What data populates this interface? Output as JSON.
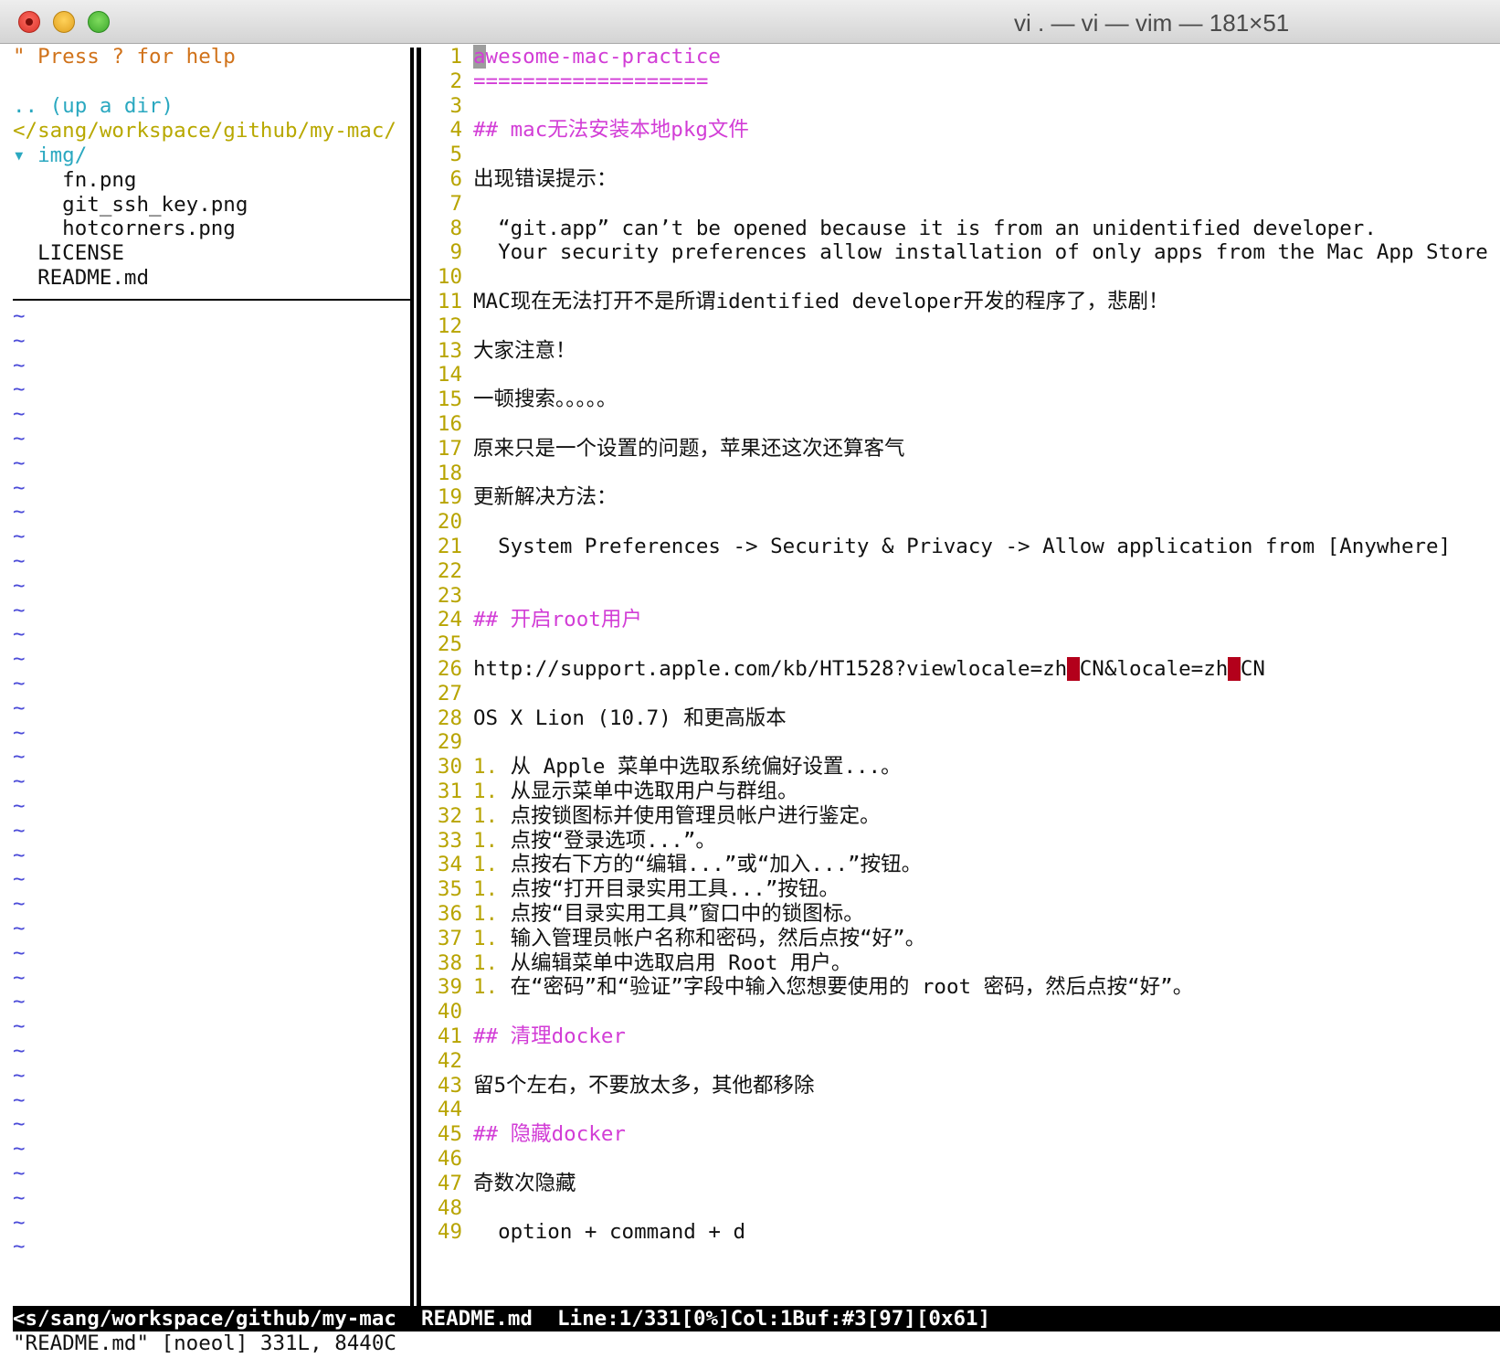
{
  "window": {
    "title": "vi . — vi — vim — 181×51"
  },
  "tree": {
    "help": "\" Press ? for help",
    "up_dir": ".. (up a dir)",
    "cwd": "</sang/workspace/github/my-mac/",
    "entries": [
      {
        "text": "▾ img/",
        "kind": "dir"
      },
      {
        "text": "    fn.png",
        "kind": "file"
      },
      {
        "text": "    git_ssh_key.png",
        "kind": "file"
      },
      {
        "text": "    hotcorners.png",
        "kind": "file"
      },
      {
        "text": "  LICENSE",
        "kind": "file"
      },
      {
        "text": "  README.md",
        "kind": "file"
      }
    ],
    "tilde": "~"
  },
  "buffer": {
    "line_numbers": [
      "1",
      "2",
      "3",
      "4",
      "5",
      "6",
      "7",
      "8",
      "9",
      "10",
      "11",
      "12",
      "13",
      "14",
      "15",
      "16",
      "17",
      "18",
      "19",
      "20",
      "21",
      "22",
      "23",
      "24",
      "25",
      "26",
      "27",
      "28",
      "29",
      "30",
      "31",
      "32",
      "33",
      "34",
      "35",
      "36",
      "37",
      "38",
      "39",
      "40",
      "41",
      "42",
      "43",
      "44",
      "45",
      "46",
      "47",
      "48",
      "49"
    ],
    "lines": [
      {
        "type": "cursorline",
        "cursor_char": "a",
        "rest": "wesome-mac-practice"
      },
      {
        "type": "heading",
        "text": "==================="
      },
      {
        "type": "text",
        "text": ""
      },
      {
        "type": "heading",
        "text": "## mac无法安装本地pkg文件"
      },
      {
        "type": "text",
        "text": ""
      },
      {
        "type": "text",
        "text": "出现错误提示："
      },
      {
        "type": "text",
        "text": ""
      },
      {
        "type": "text",
        "text": "  “git.app” can’t be opened because it is from an unidentified developer."
      },
      {
        "type": "text",
        "text": "  Your security preferences allow installation of only apps from the Mac App Store"
      },
      {
        "type": "text",
        "text": ""
      },
      {
        "type": "text",
        "text": "MAC现在无法打开不是所谓identified developer开发的程序了，悲剧！"
      },
      {
        "type": "text",
        "text": ""
      },
      {
        "type": "text",
        "text": "大家注意！"
      },
      {
        "type": "text",
        "text": ""
      },
      {
        "type": "text",
        "text": "一顿搜索。。。。。"
      },
      {
        "type": "text",
        "text": ""
      },
      {
        "type": "text",
        "text": "原来只是一个设置的问题，苹果还这次还算客气"
      },
      {
        "type": "text",
        "text": ""
      },
      {
        "type": "text",
        "text": "更新解决方法："
      },
      {
        "type": "text",
        "text": ""
      },
      {
        "type": "text",
        "text": "  System Preferences -> Security & Privacy -> Allow application from [Anywhere]"
      },
      {
        "type": "text",
        "text": ""
      },
      {
        "type": "text",
        "text": ""
      },
      {
        "type": "heading",
        "text": "## 开启root用户"
      },
      {
        "type": "text",
        "text": ""
      },
      {
        "type": "url",
        "parts": [
          "http://support.apple.com/kb/HT1528?viewlocale=zh",
          "_",
          "CN&locale=zh",
          "_",
          "CN"
        ]
      },
      {
        "type": "text",
        "text": ""
      },
      {
        "type": "text",
        "text": "OS X Lion (10.7) 和更高版本"
      },
      {
        "type": "text",
        "text": ""
      },
      {
        "type": "list",
        "marker": "1.",
        "text": " 从 Apple 菜单中选取系统偏好设置...。"
      },
      {
        "type": "list",
        "marker": "1.",
        "text": " 从显示菜单中选取用户与群组。"
      },
      {
        "type": "list",
        "marker": "1.",
        "text": " 点按锁图标并使用管理员帐户进行鉴定。"
      },
      {
        "type": "list",
        "marker": "1.",
        "text": " 点按“登录选项...”。"
      },
      {
        "type": "list",
        "marker": "1.",
        "text": " 点按右下方的“编辑...”或“加入...”按钮。"
      },
      {
        "type": "list",
        "marker": "1.",
        "text": " 点按“打开目录实用工具...”按钮。"
      },
      {
        "type": "list",
        "marker": "1.",
        "text": " 点按“目录实用工具”窗口中的锁图标。"
      },
      {
        "type": "list",
        "marker": "1.",
        "text": " 输入管理员帐户名称和密码，然后点按“好”。"
      },
      {
        "type": "list",
        "marker": "1.",
        "text": " 从编辑菜单中选取启用 Root 用户。"
      },
      {
        "type": "list",
        "marker": "1.",
        "text": " 在“密码”和“验证”字段中输入您想要使用的 root 密码，然后点按“好”。"
      },
      {
        "type": "text",
        "text": ""
      },
      {
        "type": "heading",
        "text": "## 清理docker"
      },
      {
        "type": "text",
        "text": ""
      },
      {
        "type": "text",
        "text": "留5个左右，不要放太多，其他都移除"
      },
      {
        "type": "text",
        "text": ""
      },
      {
        "type": "heading",
        "text": "## 隐藏docker"
      },
      {
        "type": "text",
        "text": ""
      },
      {
        "type": "text",
        "text": "奇数次隐藏"
      },
      {
        "type": "text",
        "text": ""
      },
      {
        "type": "text",
        "text": "  option + command + d"
      }
    ]
  },
  "statusline": {
    "left": "<s/sang/workspace/github/my-mac",
    "right": "README.md  Line:1/331[0%]Col:1Buf:#3[97][0x61]"
  },
  "cmdline": "\"README.md\" [noeol] 331L, 8440C",
  "colors": {
    "heading": "#d23dd6",
    "line_number": "#b8a400",
    "tilde": "#4a4ad8",
    "directory": "#2aa8c0",
    "comment": "#d0721a",
    "error_highlight": "#b3001b"
  }
}
